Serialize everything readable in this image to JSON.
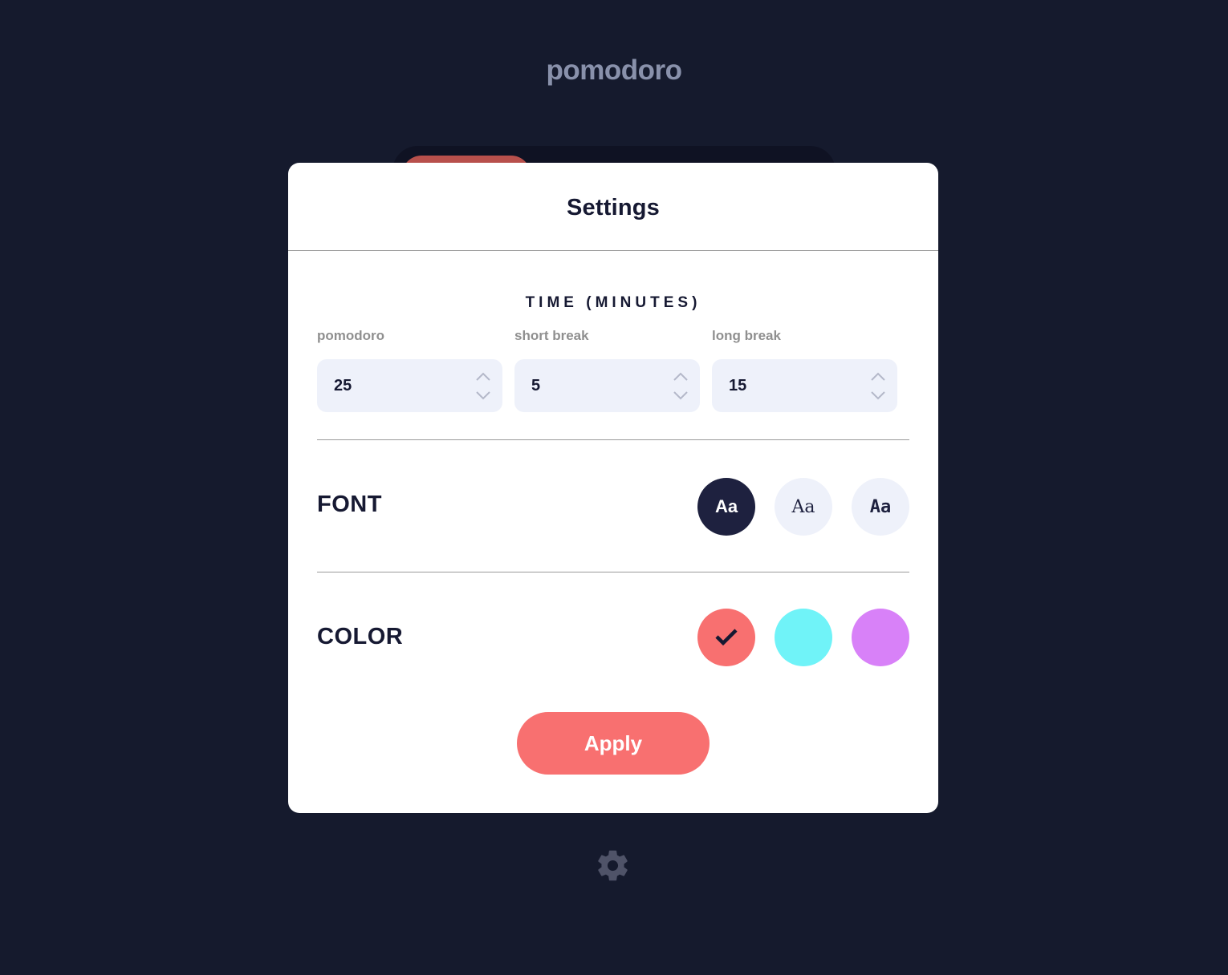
{
  "app": {
    "title": "pomodoro"
  },
  "settings": {
    "title": "Settings",
    "time": {
      "heading": "TIME (MINUTES)",
      "fields": [
        {
          "label": "pomodoro",
          "value": "25"
        },
        {
          "label": "short break",
          "value": "5"
        },
        {
          "label": "long break",
          "value": "15"
        }
      ]
    },
    "font": {
      "label": "FONT",
      "options": [
        {
          "text": "Aa",
          "selected": true
        },
        {
          "text": "Aa",
          "selected": false
        },
        {
          "text": "Aa",
          "selected": false
        }
      ]
    },
    "color": {
      "label": "COLOR",
      "options": [
        {
          "hex": "#f87070",
          "selected": true
        },
        {
          "hex": "#70f3f8",
          "selected": false
        },
        {
          "hex": "#d881f8",
          "selected": false
        }
      ]
    },
    "apply_label": "Apply"
  },
  "icons": {
    "settings": "gear-icon",
    "stepper_up": "chevron-up-icon",
    "stepper_down": "chevron-down-icon",
    "selected_color": "check-icon"
  },
  "theme": {
    "background": "#151a2d",
    "accent": "#f87070",
    "modal": "#ffffff",
    "dark": "#161932",
    "input_bg": "#eef1fa"
  }
}
